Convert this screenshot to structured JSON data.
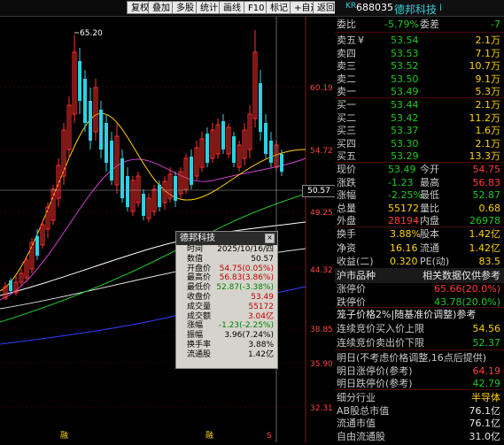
{
  "toolbar": {
    "buttons": [
      "复权",
      "叠加",
      "多股",
      "统计",
      "画线",
      "F10",
      "标记",
      "+自选",
      "返回"
    ]
  },
  "chart": {
    "y_axis_labels": [
      "60.19",
      "54.72",
      "49.25",
      "44.32",
      "38.85",
      "35.90",
      "32.31"
    ],
    "price_marker": "50.57",
    "high_label": "65.20",
    "bottom_markers": [
      "融",
      "融",
      "S"
    ]
  },
  "tooltip": {
    "title": "德邦科技",
    "rows": [
      {
        "label": "时间",
        "value": "2025/10/16/四"
      },
      {
        "label": "数值",
        "value": "50.57"
      },
      {
        "label": "开盘价",
        "value": "54.75(0.05%)"
      },
      {
        "label": "最高价",
        "value": "56.83(3.86%)"
      },
      {
        "label": "最低价",
        "value": "52.87(-3.38%)"
      },
      {
        "label": "收盘价",
        "value": "53.49"
      },
      {
        "label": "成交量",
        "value": "55172"
      },
      {
        "label": "成交额",
        "value": "3.04亿"
      },
      {
        "label": "涨幅",
        "value": "-1.23(-2.25%)"
      },
      {
        "label": "振幅",
        "value": "3.96(7.24%)"
      },
      {
        "label": "换手率",
        "value": "3.88%"
      },
      {
        "label": "流通股",
        "value": "1.42亿"
      }
    ]
  },
  "panel": {
    "header": {
      "code": "688035",
      "market_tag": "KR",
      "name": "德邦科技",
      "flag": "i"
    },
    "wei": {
      "label1": "委比",
      "val1": "-5.79%",
      "label2": "委差",
      "val2": "-7"
    },
    "sell": [
      {
        "label": "卖五",
        "mark": "¥",
        "price": "53.54",
        "vol": "2.1万"
      },
      {
        "label": "卖四",
        "mark": "",
        "price": "53.53",
        "vol": "7.1万"
      },
      {
        "label": "卖三",
        "mark": "",
        "price": "53.52",
        "vol": "10.7万"
      },
      {
        "label": "卖二",
        "mark": "",
        "price": "53.50",
        "vol": "9.1万"
      },
      {
        "label": "卖一",
        "mark": "",
        "price": "53.49",
        "vol": "5.3万"
      }
    ],
    "buy": [
      {
        "label": "买一",
        "price": "53.44",
        "vol": "2.1万"
      },
      {
        "label": "买二",
        "price": "53.42",
        "vol": "11.2万"
      },
      {
        "label": "买三",
        "price": "53.37",
        "vol": "1.6万"
      },
      {
        "label": "买四",
        "price": "53.30",
        "vol": "2.1万"
      },
      {
        "label": "买五",
        "price": "53.29",
        "vol": "13.3万"
      }
    ],
    "quote": [
      {
        "l1": "现价",
        "v1": "53.49",
        "l2": "今开",
        "v2": "54.75"
      },
      {
        "l1": "涨跌",
        "v1": "-1.23",
        "l2": "最高",
        "v2": "56.83"
      },
      {
        "l1": "涨幅",
        "v1": "-2.25%",
        "l2": "最低",
        "v2": "52.87"
      },
      {
        "l1": "总量",
        "v1": "55172",
        "l2": "量比",
        "v2": "0.68"
      },
      {
        "l1": "外盘",
        "v1": "28194",
        "l2": "内盘",
        "v2": "26978"
      }
    ],
    "stats": [
      {
        "l1": "换手",
        "v1": "3.88%",
        "l2": "股本",
        "v2": "1.42亿"
      },
      {
        "l1": "净资",
        "v1": "16.16",
        "l2": "流通",
        "v2": "1.42亿"
      },
      {
        "l1": "收益(二)",
        "v1": "0.320",
        "l2": "PE(动)",
        "v2": "83.5"
      }
    ],
    "section": {
      "left": "沪市品种",
      "right": "相关数据仅供参考"
    },
    "limits": [
      {
        "label": "涨停价",
        "value": "65.66(20.0%)"
      },
      {
        "label": "跌停价",
        "value": "43.78(20.0%)"
      }
    ],
    "auction": {
      "title": "笼子价格2%|随基准价调整)参考",
      "rows": [
        {
          "label": "连续竞价买入价上限",
          "value": "54.56"
        },
        {
          "label": "连续竞价卖出价下限",
          "value": "52.37"
        }
      ]
    },
    "tomorrow": [
      {
        "label": "明日(不考虑价格调整,16点后提供)",
        "value": ""
      },
      {
        "label": "明日涨停价(参考)",
        "value": "64.19"
      },
      {
        "label": "明日跌停价(参考)",
        "value": "42.79"
      }
    ],
    "industry": [
      {
        "label": "细分行业",
        "value": "半导体"
      },
      {
        "label": "AB股总市值",
        "value": "76.1亿"
      },
      {
        "label": "流通市值",
        "value": "76.1亿"
      },
      {
        "label": "自由流通股",
        "value": "31.0亿"
      }
    ]
  }
}
